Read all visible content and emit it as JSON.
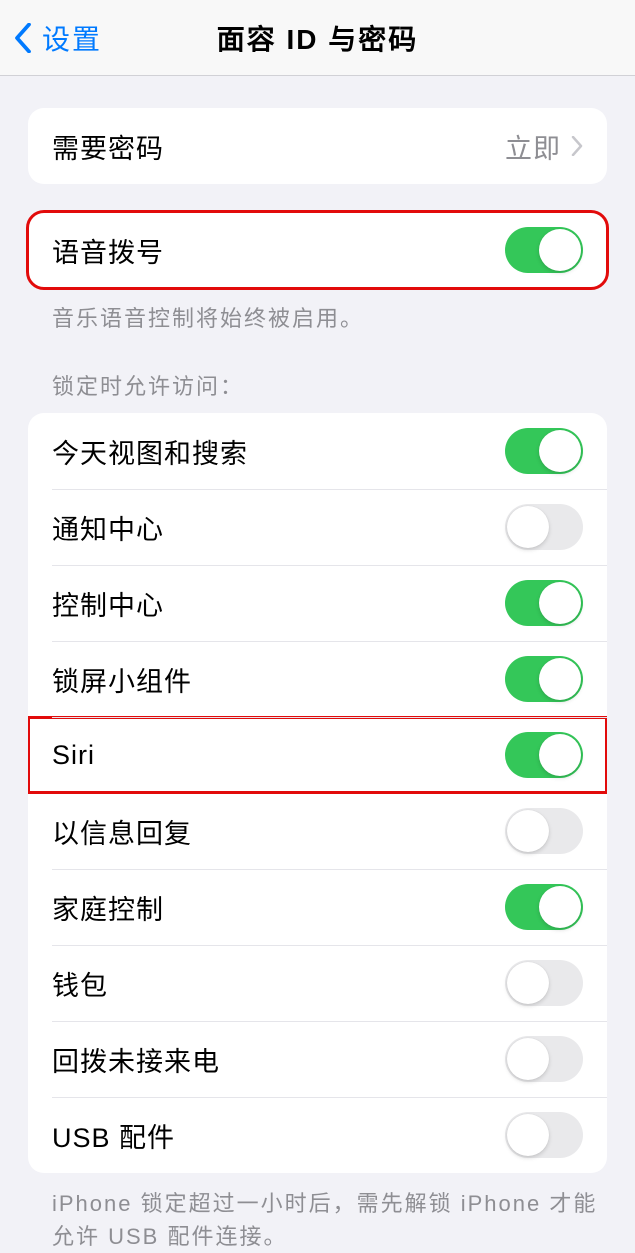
{
  "nav": {
    "back_label": "设置",
    "title": "面容 ID 与密码"
  },
  "require_passcode": {
    "label": "需要密码",
    "value": "立即"
  },
  "voice_dial": {
    "label": "语音拨号",
    "enabled": true,
    "footer": "音乐语音控制将始终被启用。"
  },
  "lock_access": {
    "header": "锁定时允许访问：",
    "items": [
      {
        "label": "今天视图和搜索",
        "enabled": true
      },
      {
        "label": "通知中心",
        "enabled": false
      },
      {
        "label": "控制中心",
        "enabled": true
      },
      {
        "label": "锁屏小组件",
        "enabled": true
      },
      {
        "label": "Siri",
        "enabled": true
      },
      {
        "label": "以信息回复",
        "enabled": false
      },
      {
        "label": "家庭控制",
        "enabled": true
      },
      {
        "label": "钱包",
        "enabled": false
      },
      {
        "label": "回拨未接来电",
        "enabled": false
      },
      {
        "label": "USB 配件",
        "enabled": false
      }
    ],
    "footer": "iPhone 锁定超过一小时后，需先解锁 iPhone 才能允许 USB 配件连接。"
  },
  "highlights": {
    "voice_dial_group": true,
    "siri_row_index": 4
  }
}
